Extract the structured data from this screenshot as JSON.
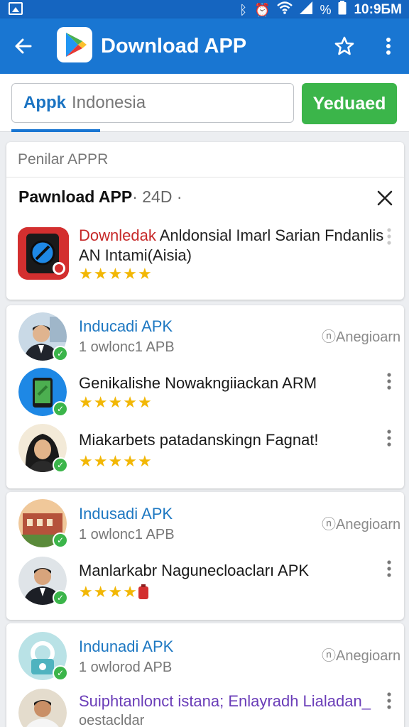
{
  "status_bar": {
    "time": "10:9БМ",
    "battery_text": "%",
    "icons": [
      "gallery-icon",
      "bluetooth-icon",
      "alarm-icon",
      "wifi-icon",
      "signal-icon",
      "battery-icon"
    ]
  },
  "app_bar": {
    "title": "Download APP",
    "icons": [
      "back-arrow-icon",
      "play-store-logo-icon",
      "star-outline-icon",
      "more-vert-icon"
    ]
  },
  "search": {
    "chip": "Appk",
    "value": "Indonesia",
    "button_label": "Yeduaed"
  },
  "card1": {
    "header": "Penilar APPR",
    "title": "Pawnload APP",
    "meta": "· 24D ·",
    "item": {
      "title_red": "Downledak",
      "title_rest": "Anldonsial Imarl Sarian Fndanlis AN Intami(Aisia)",
      "rating": 5
    }
  },
  "card2": {
    "rows": [
      {
        "title": "Inducadi APK",
        "subtitle": "1 owlonc1 APB",
        "source": "ⓝAnegioarn"
      },
      {
        "title": "Genikalishe Nowakngiiackan ARM",
        "rating": 5
      },
      {
        "title": "Miakarbets patadanskingn Fagnat!",
        "rating": 5
      }
    ]
  },
  "card3": {
    "rows": [
      {
        "title": "Indusadi APK",
        "subtitle": "1 owlonc1 APB",
        "source": "ⓝAnegioarn"
      },
      {
        "title": "Manlarkabr Nagunecloacları APK",
        "rating": 4
      }
    ]
  },
  "card4": {
    "rows": [
      {
        "title": "Indunadi APK",
        "subtitle": "1 owlorod APB",
        "source": "ⓝAnegioarn"
      },
      {
        "title": "Suiphtanlonct istana; Enlayradh Lialadan_",
        "subtitle": "oestacldar"
      }
    ]
  },
  "colors": {
    "app_bar": "#1976d2",
    "status_bar": "#1565c0",
    "button_green": "#3bb54a",
    "link_blue": "#1e78c2",
    "star": "#f2b705",
    "alert_red": "#c62828"
  }
}
